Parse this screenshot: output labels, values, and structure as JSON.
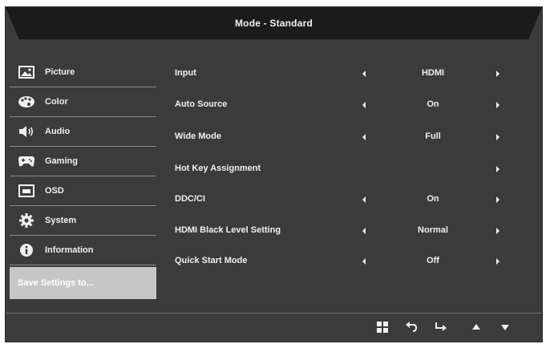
{
  "header": {
    "title": "Mode - Standard"
  },
  "sidebar": {
    "items": [
      {
        "label": "Picture",
        "icon": "picture-icon"
      },
      {
        "label": "Color",
        "icon": "palette-icon"
      },
      {
        "label": "Audio",
        "icon": "speaker-icon"
      },
      {
        "label": "Gaming",
        "icon": "gamepad-icon"
      },
      {
        "label": "OSD",
        "icon": "osd-icon"
      },
      {
        "label": "System",
        "icon": "gear-icon"
      },
      {
        "label": "Information",
        "icon": "info-icon"
      }
    ],
    "save_label": "Save Settings to..."
  },
  "settings": [
    {
      "label": "Input",
      "value": "HDMI",
      "has_left": true
    },
    {
      "label": "Auto Source",
      "value": "On",
      "has_left": true
    },
    {
      "label": "Wide Mode",
      "value": "Full",
      "has_left": true
    },
    {
      "label": "Hot Key Assignment",
      "value": "",
      "has_left": false
    },
    {
      "label": "DDC/CI",
      "value": "On",
      "has_left": true
    },
    {
      "label": "HDMI Black Level Setting",
      "value": "Normal",
      "has_left": true
    },
    {
      "label": "Quick Start Mode",
      "value": "Off",
      "has_left": true
    }
  ],
  "footer": {
    "buttons": [
      "menu-grid-icon",
      "back-icon",
      "enter-icon",
      "up-arrow-icon",
      "down-arrow-icon"
    ]
  },
  "colors": {
    "panel": "#3b3b3b",
    "header": "#1b1b1b",
    "text": "#f0f0f0",
    "save_highlight": "#c6c6c6"
  }
}
